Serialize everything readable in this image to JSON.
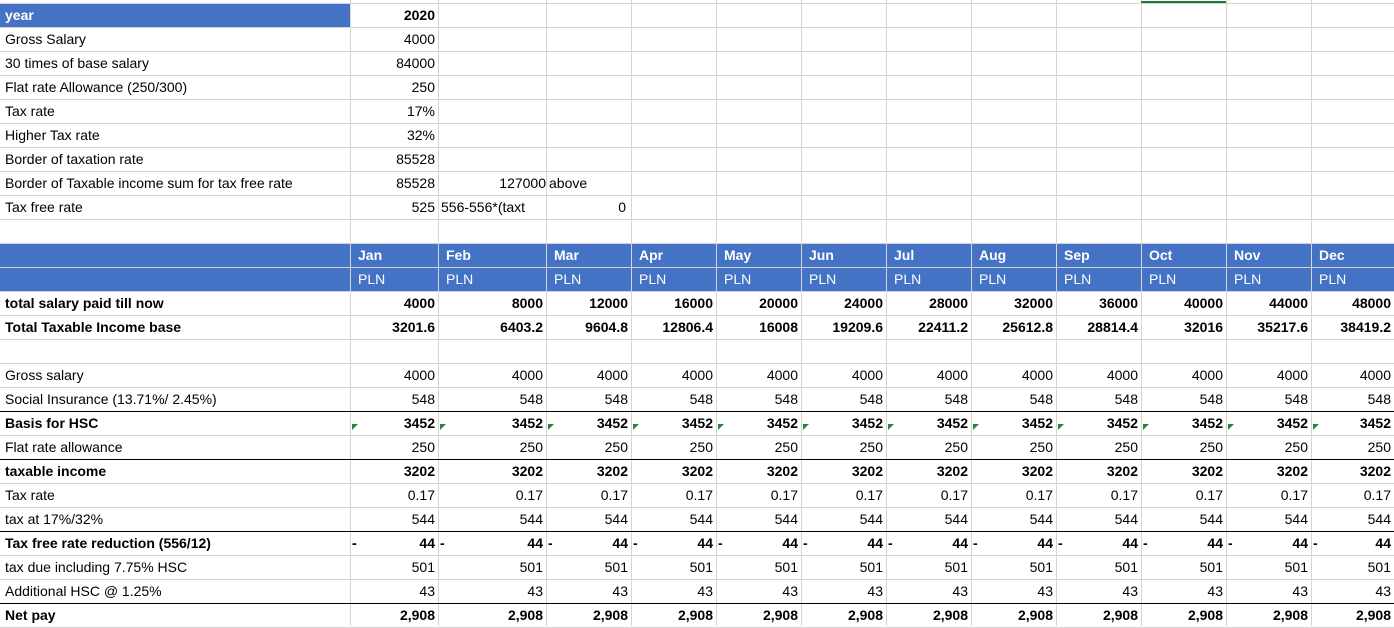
{
  "params": {
    "rows": [
      {
        "label": "year",
        "value": "2020"
      },
      {
        "label": "Gross Salary",
        "value": "4000"
      },
      {
        "label": "30 times of base salary",
        "value": "84000"
      },
      {
        "label": "Flat rate Allowance (250/300)",
        "value": "250"
      },
      {
        "label": "Tax rate",
        "value": "17%"
      },
      {
        "label": "Higher Tax rate",
        "value": "32%"
      },
      {
        "label": "Border of taxation rate",
        "value": "85528"
      },
      {
        "label": "Border of Taxable income sum for tax free rate",
        "value": "85528",
        "extra1": "127000",
        "extra2": "above"
      },
      {
        "label": "Tax free rate",
        "value": "525",
        "extra1": "556-556*(taxt",
        "extra3": "0"
      }
    ]
  },
  "months": [
    "Jan",
    "Feb",
    "Mar",
    "Apr",
    "May",
    "Jun",
    "Jul",
    "Aug",
    "Sep",
    "Oct",
    "Nov",
    "Dec"
  ],
  "currency": "PLN",
  "summary": [
    {
      "label": "total salary paid till now",
      "values": [
        "4000",
        "8000",
        "12000",
        "16000",
        "20000",
        "24000",
        "28000",
        "32000",
        "36000",
        "40000",
        "44000",
        "48000"
      ]
    },
    {
      "label": "Total Taxable Income base",
      "values": [
        "3201.6",
        "6403.2",
        "9604.8",
        "12806.4",
        "16008",
        "19209.6",
        "22411.2",
        "25612.8",
        "28814.4",
        "32016",
        "35217.6",
        "38419.2"
      ]
    }
  ],
  "calc": [
    {
      "label": "Gross salary",
      "bold": false,
      "value": "4000"
    },
    {
      "label": "Social Insurance (13.71%/ 2.45%)",
      "bold": false,
      "value": "548"
    },
    {
      "label": "Basis for HSC",
      "bold": true,
      "value": "3452"
    },
    {
      "label": "Flat rate allowance",
      "bold": false,
      "value": "250"
    },
    {
      "label": "taxable income",
      "bold": true,
      "value": "3202"
    },
    {
      "label": "Tax rate",
      "bold": false,
      "value": "0.17"
    },
    {
      "label": "tax at 17%/32%",
      "bold": false,
      "value": "544"
    },
    {
      "label": "Tax free rate reduction (556/12)",
      "bold": true,
      "value": "44",
      "dash": "-"
    },
    {
      "label": "tax due including 7.75% HSC",
      "bold": false,
      "value": "501"
    },
    {
      "label": "Additional HSC @ 1.25%",
      "bold": false,
      "value": "43"
    },
    {
      "label": "Net pay",
      "bold": true,
      "value": "2,908"
    }
  ],
  "colors": {
    "header_blue": "#4472c4",
    "gridline": "#d4d4d4",
    "comment_marker": "#1e8a2e"
  }
}
